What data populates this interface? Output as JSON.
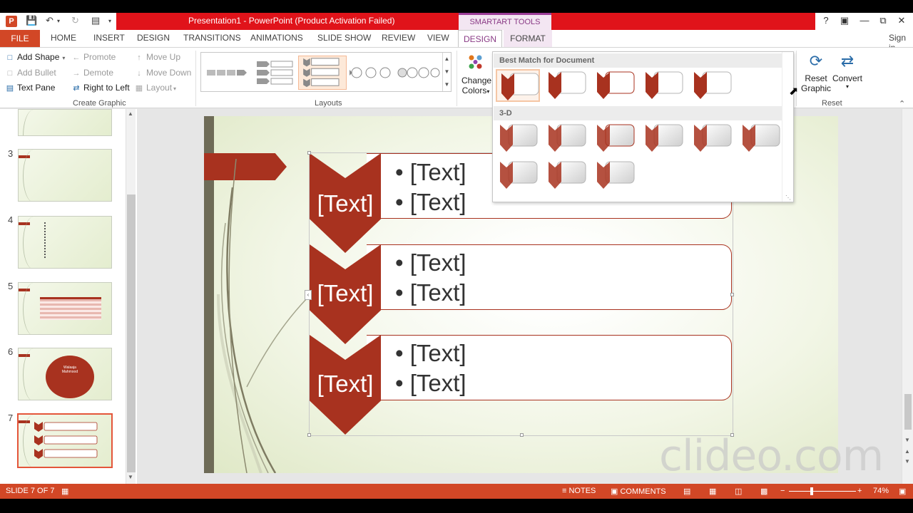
{
  "window": {
    "title": "Presentation1 -  PowerPoint (Product Activation Failed)",
    "contextual_tab_group": "SMARTART TOOLS",
    "help": "?",
    "sign_in": "Sign in"
  },
  "tabs": [
    "FILE",
    "HOME",
    "INSERT",
    "DESIGN",
    "TRANSITIONS",
    "ANIMATIONS",
    "SLIDE SHOW",
    "REVIEW",
    "VIEW",
    "DESIGN",
    "FORMAT"
  ],
  "ribbon": {
    "create_graphic": {
      "add_shape": "Add Shape",
      "add_bullet": "Add Bullet",
      "text_pane": "Text Pane",
      "promote": "Promote",
      "demote": "Demote",
      "right_to_left": "Right to Left",
      "move_up": "Move Up",
      "move_down": "Move Down",
      "layout": "Layout",
      "label": "Create Graphic"
    },
    "layouts_label": "Layouts",
    "change_colors_line1": "Change",
    "change_colors_line2": "Colors",
    "reset_graphic_line1": "Reset",
    "reset_graphic_line2": "Graphic",
    "convert": "Convert",
    "reset_label": "Reset"
  },
  "styles_panel": {
    "section1": "Best Match for Document",
    "section2": "3-D"
  },
  "thumbnails": [
    {
      "num": "3"
    },
    {
      "num": "4"
    },
    {
      "num": "5"
    },
    {
      "num": "6",
      "text1": "Walaaja",
      "text2": "Mahmood"
    },
    {
      "num": "7"
    }
  ],
  "slide": {
    "items": [
      {
        "label": "[Text]",
        "bullets": [
          "• [Text]",
          "• [Text]"
        ]
      },
      {
        "label": "[Text]",
        "bullets": [
          "• [Text]",
          "• [Text]"
        ]
      },
      {
        "label": "[Text]",
        "bullets": [
          "• [Text]",
          "• [Text]"
        ]
      }
    ]
  },
  "watermark": "clideo.com",
  "status": {
    "slide_indicator": "SLIDE 7 OF 7",
    "notes": "NOTES",
    "comments": "COMMENTS",
    "zoom": "74%"
  },
  "colors": {
    "accent": "#d24726",
    "title_bar_red": "#e0131a",
    "smartart_red": "#a8321f",
    "contextual_purple": "#8a3b86"
  }
}
